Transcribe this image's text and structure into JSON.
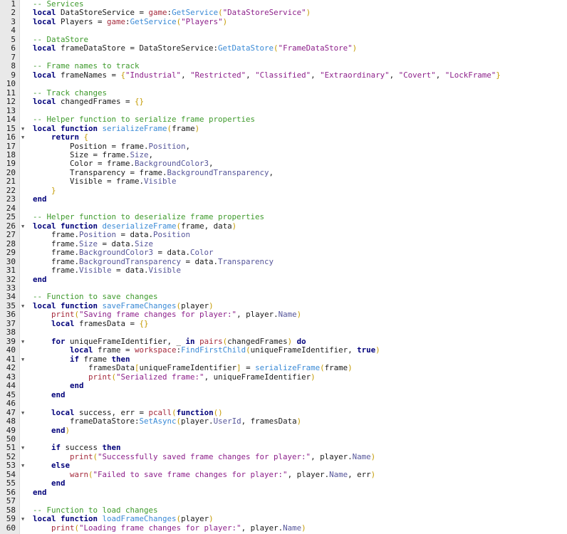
{
  "editor": {
    "colors": {
      "keyword": "#00007a",
      "comment": "#3e9a2c",
      "string": "#8c1f8a",
      "builtin": "#a52a3c",
      "method": "#3a8ad6",
      "property": "#55559a",
      "bracket": "#c49a00"
    },
    "fold_lines": [
      15,
      16,
      26,
      35,
      39,
      41,
      47,
      51,
      53,
      59
    ],
    "lines": [
      [
        [
          "c",
          "-- Services"
        ]
      ],
      [
        [
          "k",
          "local"
        ],
        [
          "t",
          " DataStoreService = "
        ],
        [
          "b",
          "game"
        ],
        [
          "t",
          ":"
        ],
        [
          "m",
          "GetService"
        ],
        [
          "y",
          "("
        ],
        [
          "s",
          "\"DataStoreService\""
        ],
        [
          "y",
          ")"
        ]
      ],
      [
        [
          "k",
          "local"
        ],
        [
          "t",
          " Players = "
        ],
        [
          "b",
          "game"
        ],
        [
          "t",
          ":"
        ],
        [
          "m",
          "GetService"
        ],
        [
          "y",
          "("
        ],
        [
          "s",
          "\"Players\""
        ],
        [
          "y",
          ")"
        ]
      ],
      [],
      [
        [
          "c",
          "-- DataStore"
        ]
      ],
      [
        [
          "k",
          "local"
        ],
        [
          "t",
          " frameDataStore = DataStoreService:"
        ],
        [
          "m",
          "GetDataStore"
        ],
        [
          "y",
          "("
        ],
        [
          "s",
          "\"FrameDataStore\""
        ],
        [
          "y",
          ")"
        ]
      ],
      [],
      [
        [
          "c",
          "-- Frame names to track"
        ]
      ],
      [
        [
          "k",
          "local"
        ],
        [
          "t",
          " frameNames = "
        ],
        [
          "y",
          "{"
        ],
        [
          "s",
          "\"Industrial\""
        ],
        [
          "t",
          ", "
        ],
        [
          "s",
          "\"Restricted\""
        ],
        [
          "t",
          ", "
        ],
        [
          "s",
          "\"Classified\""
        ],
        [
          "t",
          ", "
        ],
        [
          "s",
          "\"Extraordinary\""
        ],
        [
          "t",
          ", "
        ],
        [
          "s",
          "\"Covert\""
        ],
        [
          "t",
          ", "
        ],
        [
          "s",
          "\"LockFrame\""
        ],
        [
          "y",
          "}"
        ]
      ],
      [],
      [
        [
          "c",
          "-- Track changes"
        ]
      ],
      [
        [
          "k",
          "local"
        ],
        [
          "t",
          " changedFrames = "
        ],
        [
          "y",
          "{}"
        ]
      ],
      [],
      [
        [
          "c",
          "-- Helper function to serialize frame properties"
        ]
      ],
      [
        [
          "k",
          "local function"
        ],
        [
          "t",
          " "
        ],
        [
          "m",
          "serializeFrame"
        ],
        [
          "y",
          "("
        ],
        [
          "t",
          "frame"
        ],
        [
          "y",
          ")"
        ]
      ],
      [
        [
          "t",
          "    "
        ],
        [
          "k",
          "return"
        ],
        [
          "t",
          " "
        ],
        [
          "y",
          "{"
        ]
      ],
      [
        [
          "t",
          "        Position = frame."
        ],
        [
          "p",
          "Position"
        ],
        [
          "t",
          ","
        ]
      ],
      [
        [
          "t",
          "        Size = frame."
        ],
        [
          "p",
          "Size"
        ],
        [
          "t",
          ","
        ]
      ],
      [
        [
          "t",
          "        Color = frame."
        ],
        [
          "p",
          "BackgroundColor3"
        ],
        [
          "t",
          ","
        ]
      ],
      [
        [
          "t",
          "        Transparency = frame."
        ],
        [
          "p",
          "BackgroundTransparency"
        ],
        [
          "t",
          ","
        ]
      ],
      [
        [
          "t",
          "        Visible = frame."
        ],
        [
          "p",
          "Visible"
        ]
      ],
      [
        [
          "t",
          "    "
        ],
        [
          "y",
          "}"
        ]
      ],
      [
        [
          "k",
          "end"
        ]
      ],
      [],
      [
        [
          "c",
          "-- Helper function to deserialize frame properties"
        ]
      ],
      [
        [
          "k",
          "local function"
        ],
        [
          "t",
          " "
        ],
        [
          "m",
          "deserializeFrame"
        ],
        [
          "y",
          "("
        ],
        [
          "t",
          "frame, data"
        ],
        [
          "y",
          ")"
        ]
      ],
      [
        [
          "t",
          "    frame."
        ],
        [
          "p",
          "Position"
        ],
        [
          "t",
          " = data."
        ],
        [
          "p",
          "Position"
        ]
      ],
      [
        [
          "t",
          "    frame."
        ],
        [
          "p",
          "Size"
        ],
        [
          "t",
          " = data."
        ],
        [
          "p",
          "Size"
        ]
      ],
      [
        [
          "t",
          "    frame."
        ],
        [
          "p",
          "BackgroundColor3"
        ],
        [
          "t",
          " = data."
        ],
        [
          "p",
          "Color"
        ]
      ],
      [
        [
          "t",
          "    frame."
        ],
        [
          "p",
          "BackgroundTransparency"
        ],
        [
          "t",
          " = data."
        ],
        [
          "p",
          "Transparency"
        ]
      ],
      [
        [
          "t",
          "    frame."
        ],
        [
          "p",
          "Visible"
        ],
        [
          "t",
          " = data."
        ],
        [
          "p",
          "Visible"
        ]
      ],
      [
        [
          "k",
          "end"
        ]
      ],
      [],
      [
        [
          "c",
          "-- Function to save changes"
        ]
      ],
      [
        [
          "k",
          "local function"
        ],
        [
          "t",
          " "
        ],
        [
          "m",
          "saveFrameChanges"
        ],
        [
          "y",
          "("
        ],
        [
          "t",
          "player"
        ],
        [
          "y",
          ")"
        ]
      ],
      [
        [
          "t",
          "    "
        ],
        [
          "b",
          "print"
        ],
        [
          "y",
          "("
        ],
        [
          "s",
          "\"Saving frame changes for player:\""
        ],
        [
          "t",
          ", player."
        ],
        [
          "p",
          "Name"
        ],
        [
          "y",
          ")"
        ]
      ],
      [
        [
          "t",
          "    "
        ],
        [
          "k",
          "local"
        ],
        [
          "t",
          " framesData = "
        ],
        [
          "y",
          "{}"
        ]
      ],
      [],
      [
        [
          "t",
          "    "
        ],
        [
          "k",
          "for"
        ],
        [
          "t",
          " uniqueFrameIdentifier, _ "
        ],
        [
          "k",
          "in"
        ],
        [
          "t",
          " "
        ],
        [
          "b",
          "pairs"
        ],
        [
          "y",
          "("
        ],
        [
          "t",
          "changedFrames"
        ],
        [
          "y",
          ")"
        ],
        [
          "t",
          " "
        ],
        [
          "k",
          "do"
        ]
      ],
      [
        [
          "t",
          "        "
        ],
        [
          "k",
          "local"
        ],
        [
          "t",
          " frame = "
        ],
        [
          "b",
          "workspace"
        ],
        [
          "t",
          ":"
        ],
        [
          "m",
          "FindFirstChild"
        ],
        [
          "y",
          "("
        ],
        [
          "t",
          "uniqueFrameIdentifier, "
        ],
        [
          "k",
          "true"
        ],
        [
          "y",
          ")"
        ]
      ],
      [
        [
          "t",
          "        "
        ],
        [
          "k",
          "if"
        ],
        [
          "t",
          " frame "
        ],
        [
          "k",
          "then"
        ]
      ],
      [
        [
          "t",
          "            framesData"
        ],
        [
          "y",
          "["
        ],
        [
          "t",
          "uniqueFrameIdentifier"
        ],
        [
          "y",
          "]"
        ],
        [
          "t",
          " = "
        ],
        [
          "m",
          "serializeFrame"
        ],
        [
          "y",
          "("
        ],
        [
          "t",
          "frame"
        ],
        [
          "y",
          ")"
        ]
      ],
      [
        [
          "t",
          "            "
        ],
        [
          "b",
          "print"
        ],
        [
          "y",
          "("
        ],
        [
          "s",
          "\"Serialized frame:\""
        ],
        [
          "t",
          ", uniqueFrameIdentifier"
        ],
        [
          "y",
          ")"
        ]
      ],
      [
        [
          "t",
          "        "
        ],
        [
          "k",
          "end"
        ]
      ],
      [
        [
          "t",
          "    "
        ],
        [
          "k",
          "end"
        ]
      ],
      [],
      [
        [
          "t",
          "    "
        ],
        [
          "k",
          "local"
        ],
        [
          "t",
          " success, err = "
        ],
        [
          "b",
          "pcall"
        ],
        [
          "y",
          "("
        ],
        [
          "k",
          "function"
        ],
        [
          "y",
          "()"
        ]
      ],
      [
        [
          "t",
          "        frameDataStore:"
        ],
        [
          "m",
          "SetAsync"
        ],
        [
          "y",
          "("
        ],
        [
          "t",
          "player."
        ],
        [
          "p",
          "UserId"
        ],
        [
          "t",
          ", framesData"
        ],
        [
          "y",
          ")"
        ]
      ],
      [
        [
          "t",
          "    "
        ],
        [
          "k",
          "end"
        ],
        [
          "y",
          ")"
        ]
      ],
      [],
      [
        [
          "t",
          "    "
        ],
        [
          "k",
          "if"
        ],
        [
          "t",
          " success "
        ],
        [
          "k",
          "then"
        ]
      ],
      [
        [
          "t",
          "        "
        ],
        [
          "b",
          "print"
        ],
        [
          "y",
          "("
        ],
        [
          "s",
          "\"Successfully saved frame changes for player:\""
        ],
        [
          "t",
          ", player."
        ],
        [
          "p",
          "Name"
        ],
        [
          "y",
          ")"
        ]
      ],
      [
        [
          "t",
          "    "
        ],
        [
          "k",
          "else"
        ]
      ],
      [
        [
          "t",
          "        "
        ],
        [
          "b",
          "warn"
        ],
        [
          "y",
          "("
        ],
        [
          "s",
          "\"Failed to save frame changes for player:\""
        ],
        [
          "t",
          ", player."
        ],
        [
          "p",
          "Name"
        ],
        [
          "t",
          ", err"
        ],
        [
          "y",
          ")"
        ]
      ],
      [
        [
          "t",
          "    "
        ],
        [
          "k",
          "end"
        ]
      ],
      [
        [
          "k",
          "end"
        ]
      ],
      [],
      [
        [
          "c",
          "-- Function to load changes"
        ]
      ],
      [
        [
          "k",
          "local function"
        ],
        [
          "t",
          " "
        ],
        [
          "m",
          "loadFrameChanges"
        ],
        [
          "y",
          "("
        ],
        [
          "t",
          "player"
        ],
        [
          "y",
          ")"
        ]
      ],
      [
        [
          "t",
          "    "
        ],
        [
          "b",
          "print"
        ],
        [
          "y",
          "("
        ],
        [
          "s",
          "\"Loading frame changes for player:\""
        ],
        [
          "t",
          ", player."
        ],
        [
          "p",
          "Name"
        ],
        [
          "y",
          ")"
        ]
      ]
    ]
  }
}
